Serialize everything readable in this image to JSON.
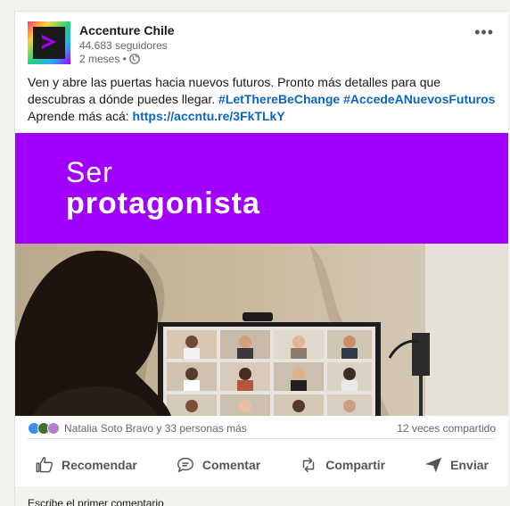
{
  "post": {
    "company": "Accenture Chile",
    "followers": "44.683 seguidores",
    "age": "2 meses •",
    "more_label": "•••",
    "text_line1": "Ven y abre las puertas hacia nuevos futuros. Pronto más detalles para que",
    "text_line2_plain": "descubras a dónde puedes llegar. ",
    "hashtag1": "#LetThereBeChange",
    "hashtag2": "#AccedeANuevosFuturos",
    "text_line3_plain": "Aprende más acá: ",
    "link": "https://accntu.re/3FkTLkY"
  },
  "banner": {
    "line1": "Ser",
    "line2": "protagonista",
    "color": "#a100ff"
  },
  "social": {
    "reactions_text": "Natalia Soto Bravo y 33 personas más",
    "shares_text": "12 veces compartido"
  },
  "actions": {
    "like": "Recomendar",
    "comment": "Comentar",
    "share": "Compartir",
    "send": "Enviar"
  },
  "comment_prompt": "Escribe el primer comentario",
  "icons": [
    "accenture-logo",
    "globe-icon",
    "more-icon",
    "like-icon",
    "comment-icon",
    "repost-icon",
    "send-icon"
  ]
}
